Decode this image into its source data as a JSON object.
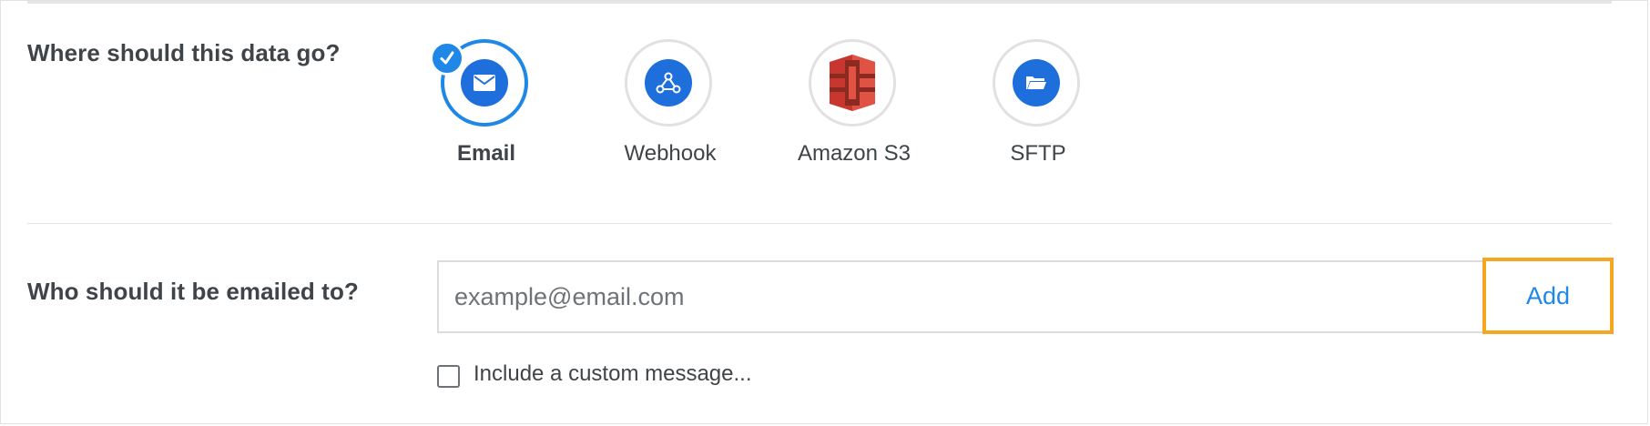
{
  "destination_section": {
    "question": "Where should this data go?",
    "options": [
      {
        "label": "Email",
        "icon": "envelope-icon",
        "selected": true
      },
      {
        "label": "Webhook",
        "icon": "webhook-icon",
        "selected": false
      },
      {
        "label": "Amazon S3",
        "icon": "amazon-s3-icon",
        "selected": false
      },
      {
        "label": "SFTP",
        "icon": "folder-icon",
        "selected": false
      }
    ],
    "selected_icon": "checkmark-icon"
  },
  "recipient_section": {
    "question": "Who should it be emailed to?",
    "email_input": {
      "value": "",
      "placeholder": "example@email.com"
    },
    "add_label": "Add",
    "custom_message_label": "Include a custom message...",
    "custom_message_checked": false
  },
  "colors": {
    "accent": "#1f87e5",
    "icon_fill": "#1e6fdc",
    "focus_outline": "#f5a623",
    "text": "#3f4448",
    "s3_red": "#c7372f"
  }
}
